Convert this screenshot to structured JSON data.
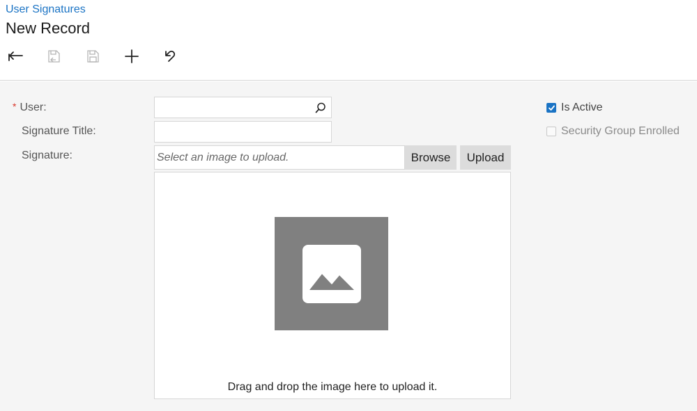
{
  "header": {
    "breadcrumb": "User Signatures",
    "title": "New Record"
  },
  "toolbar": {
    "buttons": [
      {
        "icon": "back-arrow-icon",
        "enabled": true
      },
      {
        "icon": "save-close-icon",
        "enabled": false
      },
      {
        "icon": "save-icon",
        "enabled": false
      },
      {
        "icon": "plus-icon",
        "enabled": true
      },
      {
        "icon": "undo-icon",
        "enabled": true
      }
    ]
  },
  "form": {
    "user_label": "User:",
    "user_required_mark": "*",
    "user_value": "",
    "signature_title_label": "Signature Title:",
    "signature_title_value": "",
    "signature_label": "Signature:",
    "signature_placeholder": "Select an image to upload.",
    "browse_label": "Browse",
    "upload_label": "Upload",
    "drop_text": "Drag and drop the image here to upload it."
  },
  "checkboxes": {
    "is_active_label": "Is Active",
    "is_active_checked": true,
    "security_group_label": "Security Group Enrolled",
    "security_group_checked": false
  },
  "colors": {
    "link": "#1a73c4",
    "checkbox_checked": "#1a73c4",
    "required": "#d9372c",
    "content_bg": "#f5f5f5",
    "image_placeholder": "#808080"
  }
}
